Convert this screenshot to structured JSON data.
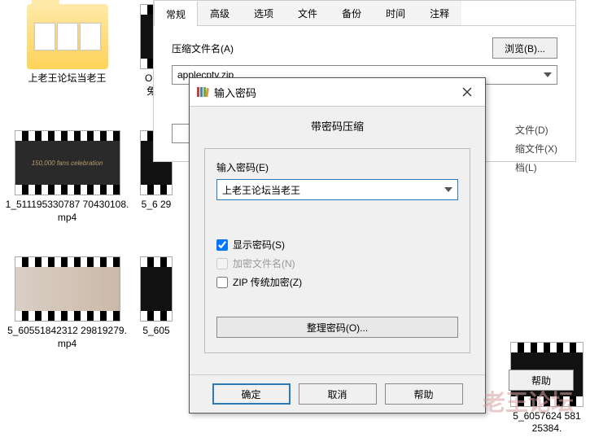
{
  "desktop": {
    "items": [
      {
        "type": "folder",
        "label": "上老王论坛当老王"
      },
      {
        "type": "video",
        "label": "On黑免-A"
      },
      {
        "type": "video",
        "label": "1_511195330787\n70430108.mp4",
        "variant": "dark",
        "overlay": "150,000 fans celebration"
      },
      {
        "type": "video",
        "label": "5_6\n29"
      },
      {
        "type": "video",
        "label": "5_60551842312\n29819279.mp4",
        "variant": "light"
      },
      {
        "type": "video",
        "label": "5_605"
      },
      {
        "type": "video",
        "label": "5_6057624\n58125384."
      }
    ]
  },
  "archive": {
    "tabs": [
      "常规",
      "高级",
      "选项",
      "文件",
      "备份",
      "时间",
      "注释"
    ],
    "active_tab": 0,
    "filename_label": "压缩文件名(A)",
    "filename_value": "applecptv.zip",
    "browse_btn": "浏览(B)...",
    "right_options": [
      "文件(D)",
      "缩文件(X)",
      "档(L)"
    ],
    "help_btn": "帮助"
  },
  "dialog": {
    "title": "输入密码",
    "subtitle": "带密码压缩",
    "password_label": "输入密码(E)",
    "password_value": "上老王论坛当老王",
    "show_password": "显示密码(S)",
    "encrypt_names": "加密文件名(N)",
    "zip_legacy": "ZIP 传统加密(Z)",
    "organize_btn": "整理密码(O)...",
    "ok": "确定",
    "cancel": "取消",
    "help": "帮助"
  },
  "watermark": "老王论坛"
}
